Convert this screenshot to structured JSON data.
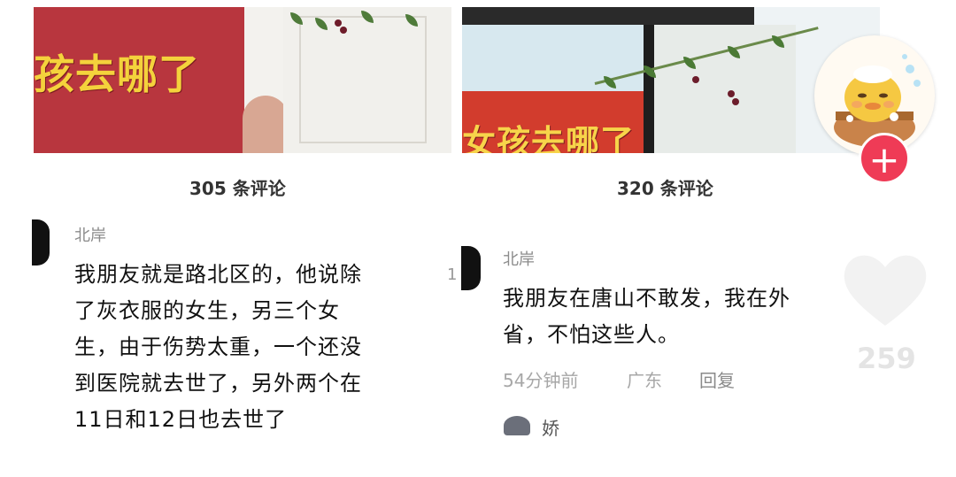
{
  "left_post": {
    "thumbnail_text": "孩去哪了",
    "comment_count": "305 条评论",
    "comment": {
      "username": "北岸",
      "lines": [
        "我朋友就是路北区的，他说除",
        "了灰衣服的女生，另三个女",
        "生，由于伤势太重，一个还没",
        "到医院就去世了，另外两个在",
        "11日和12日也去世了"
      ]
    },
    "divider_mark": "1"
  },
  "right_post": {
    "thumbnail_text": "女孩去哪了",
    "comment_count": "320 条评论",
    "comment": {
      "username": "北岸",
      "lines": [
        "我朋友在唐山不敢发，我在外",
        "省，不怕这些人。"
      ],
      "time": "54分钟前",
      "region": "广东",
      "reply_label": "回复"
    },
    "sub_reply_name": "娇"
  },
  "sidebar": {
    "follow_symbol": "+",
    "like_count": "259"
  },
  "colors": {
    "follow_red": "#ef3b56",
    "poster_red": "#b8363e",
    "poster_yellow": "#f4d23c"
  }
}
